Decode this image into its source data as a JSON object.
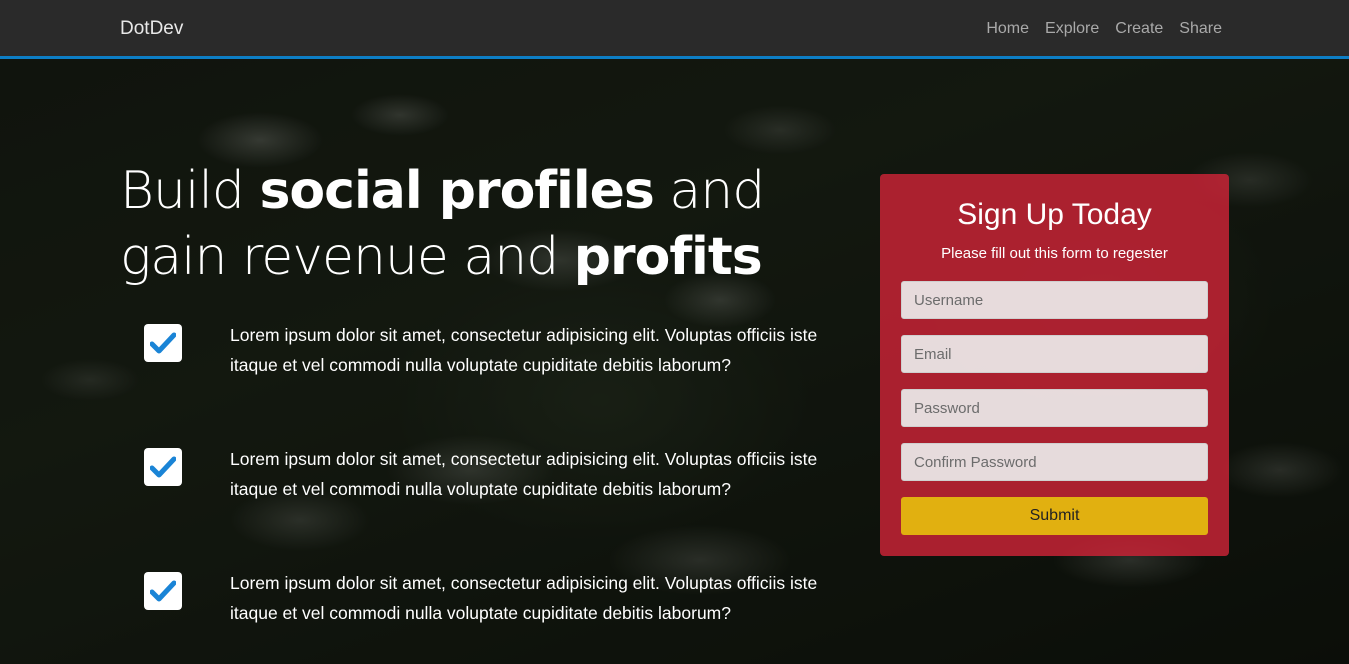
{
  "navbar": {
    "brand": "DotDev",
    "links": [
      "Home",
      "Explore",
      "Create",
      "Share"
    ],
    "accent_color": "#0d7ec5"
  },
  "hero": {
    "title_parts": [
      "Build ",
      "social profiles",
      " and gain revenue and ",
      "profits"
    ],
    "features": [
      {
        "icon": "check-icon",
        "text": "Lorem ipsum dolor sit amet, consectetur adipisicing elit. Voluptas officiis iste itaque et vel commodi nulla voluptate cupiditate debitis laborum?"
      },
      {
        "icon": "check-icon",
        "text": "Lorem ipsum dolor sit amet, consectetur adipisicing elit. Voluptas officiis iste itaque et vel commodi nulla voluptate cupiditate debitis laborum?"
      },
      {
        "icon": "check-icon",
        "text": "Lorem ipsum dolor sit amet, consectetur adipisicing elit. Voluptas officiis iste itaque et vel commodi nulla voluptate cupiditate debitis laborum?"
      }
    ]
  },
  "signup": {
    "title": "Sign Up Today",
    "subtitle": "Please fill out this form to regester",
    "fields": [
      {
        "placeholder": "Username"
      },
      {
        "placeholder": "Email"
      },
      {
        "placeholder": "Password"
      },
      {
        "placeholder": "Confirm Password"
      }
    ],
    "submit_label": "Submit",
    "card_color": "#cd2337",
    "submit_color": "#e1b010",
    "check_color": "#1a84d6"
  }
}
